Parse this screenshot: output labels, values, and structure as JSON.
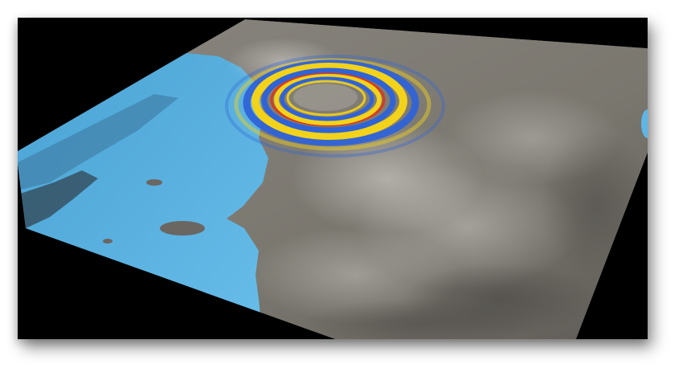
{
  "figure": {
    "subject": "",
    "colors": {
      "background": "#000000",
      "terrain": "#7d7a74",
      "water": "#5eb6e6",
      "wave_blue": "#2f63d6",
      "wave_yellow": "#f2d21a",
      "wave_red": "#d83a1e"
    }
  }
}
